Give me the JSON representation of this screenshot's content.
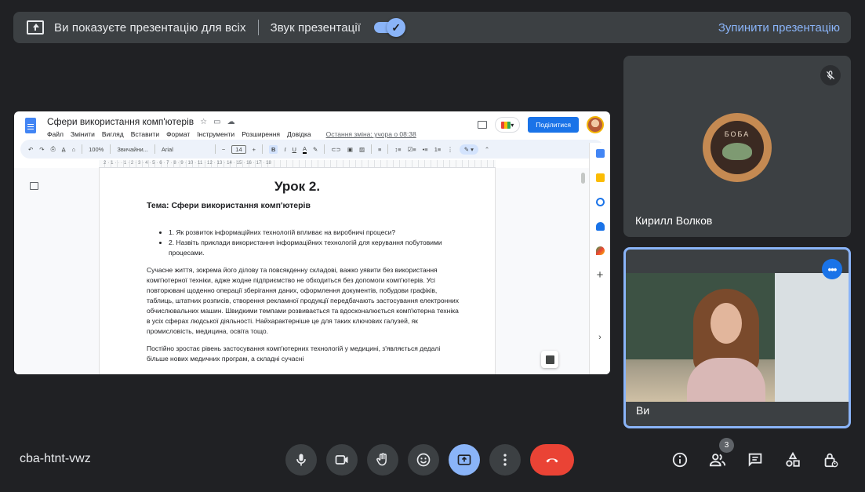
{
  "banner": {
    "presenting_text": "Ви показуєте презентацію для всіх",
    "sound_label": "Звук презентації",
    "sound_on": true,
    "stop_label": "Зупинити презентацію"
  },
  "doc": {
    "title": "Сфери використання комп'ютерів",
    "menus": [
      "Файл",
      "Змінити",
      "Вигляд",
      "Вставити",
      "Формат",
      "Інструменти",
      "Розширення",
      "Довідка"
    ],
    "last_edit": "Остання зміна: учора о 08:38",
    "share_label": "Поділитися",
    "toolbar": {
      "zoom": "100%",
      "style": "Звичайни...",
      "font": "Arial",
      "font_size": "14",
      "bold": "B",
      "italic": "I",
      "underline": "U",
      "text_color": "A"
    },
    "ruler_numbers": "2 · 1 · · · 1 · 2 · 3 · 4 · 5 · 6 · 7 · 8 · 9 · 10 · 11 · 12 · 13 · 14 · 15 · 16 · 17 · 18",
    "heading": "Урок 2.",
    "topic": "Тема: Сфери використання комп'ютерів",
    "bullets": [
      "1. Як розвиток інформаційних технологій впливає на виробничі процеси?",
      "2. Назвіть приклади використання інформаційних технологій для керування побутовими процесами."
    ],
    "paragraph1": "Сучасне життя, зокрема його ділову та повсякденну складові, важко уявити без використання комп'ютерної техніки, адже жодне підприємство не обходиться без допомоги комп'ютерів. Усі повторювані щоденно операції зберігання даних, оформлення документів, побудови графіків, таблиць, штатних розписів, створення рекламної продукції передбачають застосування електронних обчислювальних машин. Швидкими темпами розвивається та вдосконалюється комп'ютерна техніка в усіх сферах людської діяльності. Найхарактерніше це для таких ключових галузей, як промисловість, медицина, освіта тощо.",
    "paragraph2": "Постійно зростає рівень застосування комп'ютерних технологій у медицині, з'являється дедалі більше нових медичних програм, а складні сучасні"
  },
  "tiles": [
    {
      "name": "Кирилл Волков",
      "avatar_text": "БОБА",
      "muted": true
    },
    {
      "name": "Ви",
      "speaking": true
    }
  ],
  "meeting_code": "cba-htnt-vwz",
  "participants_count": "3",
  "colors": {
    "accent": "#8ab4f8",
    "end_call": "#ea4335",
    "background": "#202124",
    "surface": "#3c4043"
  },
  "icons": {
    "controls": [
      "mic-icon",
      "camera-icon",
      "raise-hand-icon",
      "emoji-icon",
      "present-icon",
      "more-options-icon",
      "end-call-icon"
    ],
    "right": [
      "info-icon",
      "people-icon",
      "chat-icon",
      "activities-icon",
      "host-controls-icon"
    ]
  }
}
